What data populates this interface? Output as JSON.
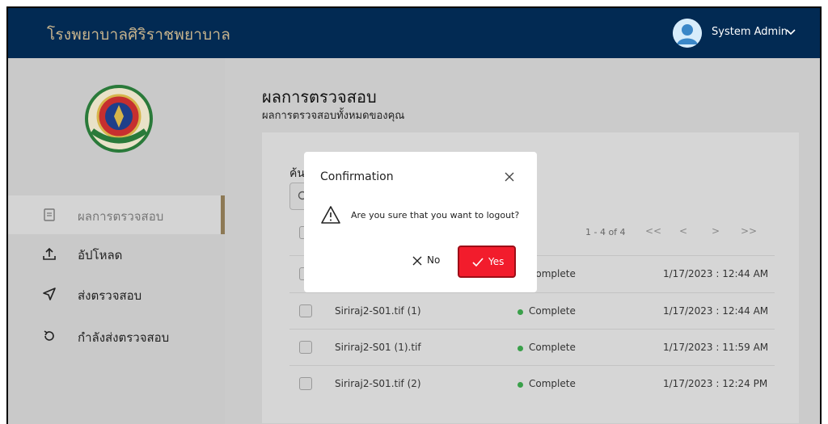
{
  "header": {
    "hospital_name": "โรงพยาบาลศิริราชพยาบาล",
    "user_name": "System Admin"
  },
  "sidebar": {
    "items": [
      {
        "label": "ผลการตรวจสอบ",
        "icon": "document-icon",
        "active": true
      },
      {
        "label": "อัปโหลด",
        "icon": "upload-icon",
        "active": false
      },
      {
        "label": "ส่งตรวจสอบ",
        "icon": "send-icon",
        "active": false
      },
      {
        "label": "กำลังส่งตรวจสอบ",
        "icon": "refresh-icon",
        "active": false
      }
    ]
  },
  "main": {
    "title": "ผลการตรวจสอบ",
    "subtitle": "ผลการตรวจสอบทั้งหมดของคุณ",
    "search_label": "ค้นห",
    "pager_text": "1 - 4 of 4",
    "pager_first": "<<",
    "pager_prev": "<",
    "pager_next": ">",
    "pager_last": ">>",
    "rows": [
      {
        "file": "",
        "status": "Complete",
        "date": "1/17/2023 : 12:44 AM"
      },
      {
        "file": "Siriraj2-S01.tif (1)",
        "status": "Complete",
        "date": "1/17/2023 : 12:44 AM"
      },
      {
        "file": "Siriraj2-S01 (1).tif",
        "status": "Complete",
        "date": "1/17/2023 : 11:59 AM"
      },
      {
        "file": "Siriraj2-S01.tif (2)",
        "status": "Complete",
        "date": "1/17/2023 : 12:24 PM"
      }
    ]
  },
  "dialog": {
    "title": "Confirmation",
    "message": "Are you sure that you want to logout?",
    "no_label": "No",
    "yes_label": "Yes"
  },
  "colors": {
    "header_bg": "#022a53",
    "brand_gold": "#c8b48d",
    "yes_button": "#f21c2c",
    "status_complete": "#3aa04a"
  }
}
